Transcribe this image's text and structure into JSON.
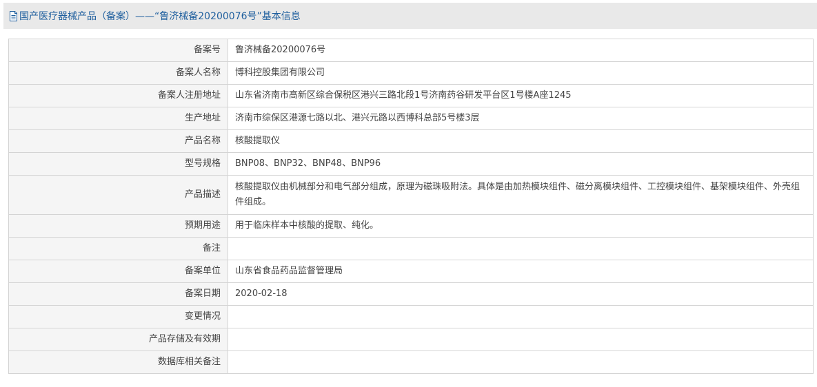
{
  "header": {
    "title": "国产医疗器械产品（备案）——“鲁济械备20200076号”基本信息",
    "icon": "document-icon",
    "title_color": "#1f5f9e"
  },
  "rows": [
    {
      "label": "备案号",
      "value": "鲁济械备20200076号"
    },
    {
      "label": "备案人名称",
      "value": "博科控股集团有限公司"
    },
    {
      "label": "备案人注册地址",
      "value": "山东省济南市高新区综合保税区港兴三路北段1号济南药谷研发平台区1号楼A座1245"
    },
    {
      "label": "生产地址",
      "value": "济南市综保区港源七路以北、港兴元路以西博科总部5号楼3层"
    },
    {
      "label": "产品名称",
      "value": "核酸提取仪"
    },
    {
      "label": "型号规格",
      "value": "BNP08、BNP32、BNP48、BNP96"
    },
    {
      "label": "产品描述",
      "value": "核酸提取仪由机械部分和电气部分组成，原理为磁珠吸附法。具体是由加热模块组件、磁分离模块组件、工控模块组件、基架模块组件、外壳组件组成。"
    },
    {
      "label": "预期用途",
      "value": "用于临床样本中核酸的提取、纯化。"
    },
    {
      "label": "备注",
      "value": ""
    },
    {
      "label": "备案单位",
      "value": "山东省食品药品监督管理局"
    },
    {
      "label": "备案日期",
      "value": "2020-02-18"
    },
    {
      "label": "变更情况",
      "value": ""
    },
    {
      "label": "产品存储及有效期",
      "value": ""
    },
    {
      "label": "数据库相关备注",
      "value": ""
    }
  ]
}
